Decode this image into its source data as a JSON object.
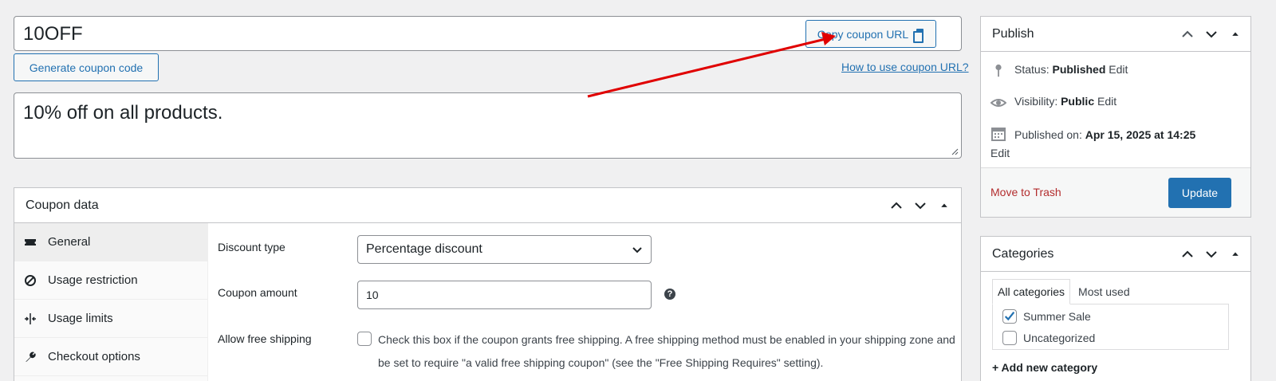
{
  "coupon": {
    "code": "10OFF",
    "copy_url_label": "Copy coupon URL",
    "generate_label": "Generate coupon code",
    "how_to_link": "How to use coupon URL?",
    "description": "10% off on all products."
  },
  "coupon_data": {
    "title": "Coupon data",
    "tabs": [
      {
        "label": "General",
        "icon": "ticket-icon"
      },
      {
        "label": "Usage restriction",
        "icon": "ban-icon"
      },
      {
        "label": "Usage limits",
        "icon": "split-arrows-icon"
      },
      {
        "label": "Checkout options",
        "icon": "wrench-icon"
      }
    ],
    "fields": {
      "discount_type_label": "Discount type",
      "discount_type_value": "Percentage discount",
      "coupon_amount_label": "Coupon amount",
      "coupon_amount_value": "10",
      "free_shipping_label": "Allow free shipping",
      "free_shipping_text": "Check this box if the coupon grants free shipping. A free shipping method must be enabled in your shipping zone and be set to require \"a valid free shipping coupon\" (see the \"Free Shipping Requires\" setting)."
    }
  },
  "publish": {
    "title": "Publish",
    "status_label": "Status:",
    "status_value": "Published",
    "visibility_label": "Visibility:",
    "visibility_value": "Public",
    "published_label": "Published on:",
    "published_value": "Apr 15, 2025 at 14:25",
    "edit_label": "Edit",
    "trash_label": "Move to Trash",
    "update_label": "Update"
  },
  "categories": {
    "title": "Categories",
    "tab_all": "All categories",
    "tab_most_used": "Most used",
    "items": [
      {
        "label": "Summer Sale",
        "checked": true
      },
      {
        "label": "Uncategorized",
        "checked": false
      }
    ],
    "add_new": "+ Add new category"
  },
  "colors": {
    "accent": "#2271b1",
    "danger": "#b32d2e",
    "annotation_arrow": "#e00000"
  }
}
